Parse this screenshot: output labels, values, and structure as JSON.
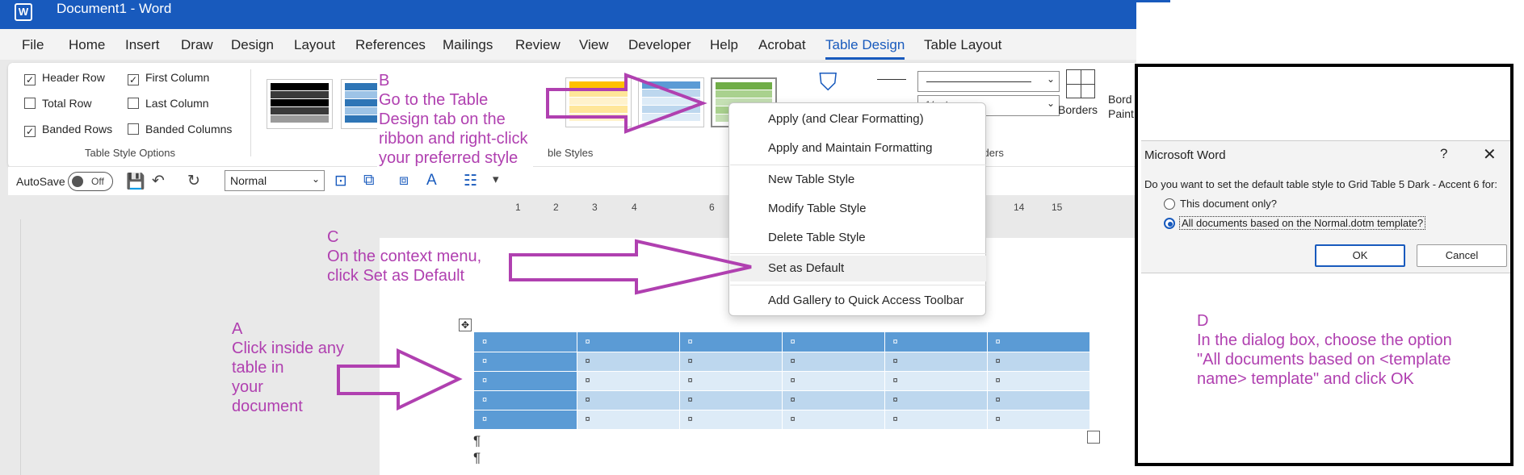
{
  "title_bar": {
    "app_icon_letter": "W",
    "title": "Document1  -  Word"
  },
  "menu_tabs": [
    "File",
    "Home",
    "Insert",
    "Draw",
    "Design",
    "Layout",
    "References",
    "Mailings",
    "Review",
    "View",
    "Developer",
    "Help",
    "Acrobat",
    "Table Design",
    "Table Layout"
  ],
  "active_tab": "Table Design",
  "style_options": {
    "group_label": "Table Style Options",
    "header_row": {
      "label": "Header Row",
      "checked": true
    },
    "first_column": {
      "label": "First Column",
      "checked": true
    },
    "total_row": {
      "label": "Total Row",
      "checked": false
    },
    "last_column": {
      "label": "Last Column",
      "checked": false
    },
    "banded_rows": {
      "label": "Banded Rows",
      "checked": true
    },
    "banded_columns": {
      "label": "Banded Columns",
      "checked": false
    }
  },
  "table_styles_group_label": "ble Styles",
  "borders": {
    "group_label": "orders",
    "borders_label": "Borders",
    "border_painter_label": "Bord Paint",
    "width_value": "½ pt"
  },
  "colors": {
    "accent": "#185abd",
    "annotation": "#b040b0",
    "table_header": "#5b9bd5",
    "band_dark": "#bdd7ee",
    "band_light": "#ddebf7"
  },
  "qat": {
    "autosave_label": "AutoSave",
    "autosave_state": "Off",
    "style_value": "Normal"
  },
  "ruler_marks": [
    "1",
    "2",
    "3",
    "4",
    "6",
    "14",
    "15"
  ],
  "context_menu": [
    {
      "label": "Apply (and Clear Formatting)"
    },
    {
      "label": "Apply and Maintain Formatting"
    },
    {
      "label": "New Table Style"
    },
    {
      "label": "Modify Table Style"
    },
    {
      "label": "Delete Table Style"
    },
    {
      "label": "Set as Default",
      "highlighted": true
    },
    {
      "label": "Add Gallery to Quick Access Toolbar"
    }
  ],
  "document_table": {
    "rows": 5,
    "cols": 6,
    "cell_mark": "¤"
  },
  "dialog": {
    "title": "Microsoft Word",
    "help": "?",
    "close": "✕",
    "question": "Do you want to set the default table style to Grid Table 5 Dark - Accent 6 for:",
    "option_this_doc": "This document only?",
    "option_all_docs": "All documents based on the Normal.dotm template?",
    "selected": "all_docs",
    "ok_label": "OK",
    "cancel_label": "Cancel"
  },
  "annotations": {
    "a": {
      "letter": "A",
      "text": "Click inside any\ntable in\nyour\ndocument"
    },
    "b": {
      "letter": "B",
      "text": "Go to the Table\nDesign tab on the\nribbon and right-click\nyour preferred style"
    },
    "c": {
      "letter": "C",
      "text": "On the context menu,\nclick Set as Default"
    },
    "d": {
      "letter": "D",
      "text": "In the dialog box, choose the option\n\"All documents based on <template\nname> template\" and click OK"
    }
  }
}
